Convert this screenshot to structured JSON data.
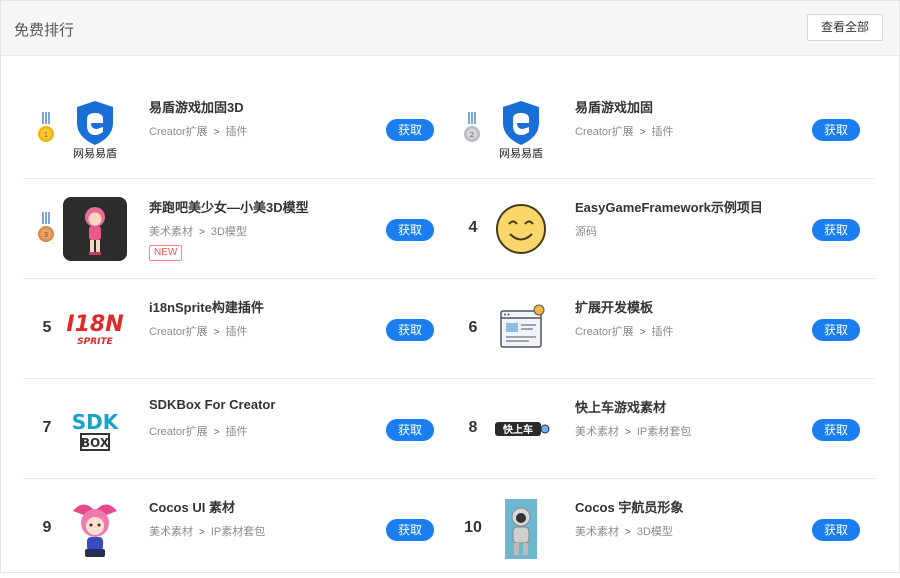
{
  "header": {
    "title": "免费排行",
    "view_all": "查看全部"
  },
  "get_label": "获取",
  "items": [
    {
      "rank": "",
      "medal": "gold",
      "icon": "netease-yidun-logo-icon",
      "icon_text": "网易易盾",
      "name": "易盾游戏加固3D",
      "category": "Creator扩展",
      "subcategory": "插件"
    },
    {
      "rank": "",
      "medal": "silver",
      "icon": "netease-yidun-logo-icon",
      "icon_text": "网易易盾",
      "name": "易盾游戏加固",
      "category": "Creator扩展",
      "subcategory": "插件"
    },
    {
      "rank": "",
      "medal": "bronze",
      "icon": "anime-girl-3d-model-icon",
      "name": "奔跑吧美少女—小美3D模型",
      "category": "美术素材",
      "subcategory": "3D模型",
      "badge": "NEW"
    },
    {
      "rank": "4",
      "icon": "smiley-face-icon",
      "name": "EasyGameFramework示例项目",
      "category": "源码",
      "subcategory": ""
    },
    {
      "rank": "5",
      "icon": "i18n-sprite-logo-icon",
      "icon_text": "I18N",
      "icon_subtext": "SPRITE",
      "name": "i18nSprite构建插件",
      "category": "Creator扩展",
      "subcategory": "插件"
    },
    {
      "rank": "6",
      "icon": "template-window-icon",
      "name": "扩展开发模板",
      "category": "Creator扩展",
      "subcategory": "插件"
    },
    {
      "rank": "7",
      "icon": "sdkbox-logo-icon",
      "icon_text": "SDK",
      "icon_subtext": "BOX",
      "name": "SDKBox For Creator",
      "category": "Creator扩展",
      "subcategory": "插件"
    },
    {
      "rank": "8",
      "icon": "kuaishangche-logo-icon",
      "icon_text": "快上车",
      "name": "快上车游戏素材",
      "category": "美术素材",
      "subcategory": "IP素材套包"
    },
    {
      "rank": "9",
      "icon": "cartoon-character-icon",
      "name": "Cocos UI 素材",
      "category": "美术素材",
      "subcategory": "IP素材套包"
    },
    {
      "rank": "10",
      "icon": "astronaut-character-icon",
      "name": "Cocos 宇航员形象",
      "category": "美术素材",
      "subcategory": "3D模型"
    }
  ],
  "colors": {
    "accent": "#1a7ef0",
    "header_bg": "#f7f7f7",
    "new_badge": "#f05a5a"
  }
}
